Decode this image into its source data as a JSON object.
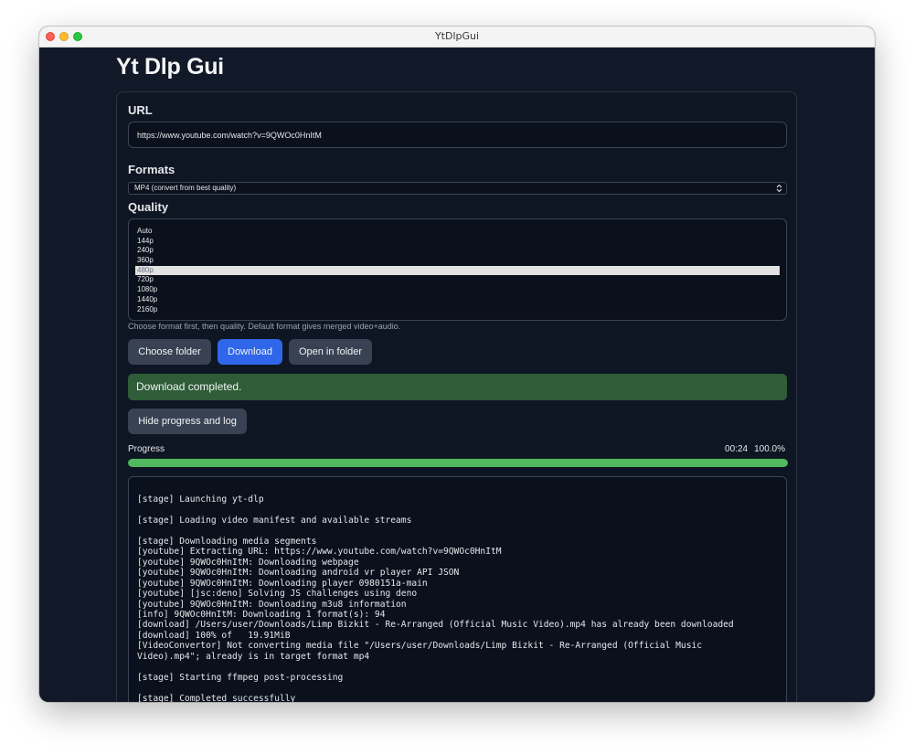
{
  "window": {
    "title": "YtDlpGui"
  },
  "app": {
    "title": "Yt Dlp Gui"
  },
  "url": {
    "label": "URL",
    "value": "https://www.youtube.com/watch?v=9QWOc0HnItM"
  },
  "formats": {
    "label": "Formats",
    "selected": "MP4 (convert from best quality)"
  },
  "quality": {
    "label": "Quality",
    "options": [
      "Auto",
      "144p",
      "240p",
      "360p",
      "480p",
      "720p",
      "1080p",
      "1440p",
      "2160p"
    ],
    "selected": "480p",
    "hint": "Choose format first, then quality. Default format gives merged video+audio."
  },
  "buttons": {
    "choose_folder": "Choose folder",
    "download": "Download",
    "open_in_folder": "Open in folder",
    "hide_progress": "Hide progress and log"
  },
  "status": {
    "message": "Download completed."
  },
  "progress": {
    "label": "Progress",
    "elapsed": "00:24",
    "percent_text": "100.0%",
    "fraction": 1.0
  },
  "log": {
    "lines": [
      "[stage] Launching yt-dlp",
      "",
      "[stage] Loading video manifest and available streams",
      "",
      "[stage] Downloading media segments",
      "[youtube] Extracting URL: https://www.youtube.com/watch?v=9QWOc0HnItM",
      "[youtube] 9QWOc0HnItM: Downloading webpage",
      "[youtube] 9QWOc0HnItM: Downloading android vr player API JSON",
      "[youtube] 9QWOc0HnItM: Downloading player 0980151a-main",
      "[youtube] [jsc:deno] Solving JS challenges using deno",
      "[youtube] 9QWOc0HnItM: Downloading m3u8 information",
      "[info] 9QWOc0HnItM: Downloading 1 format(s): 94",
      "[download] /Users/user/Downloads/Limp Bizkit - Re-Arranged (Official Music Video).mp4 has already been downloaded",
      "[download] 100% of   19.91MiB",
      "[VideoConvertor] Not converting media file \"/Users/user/Downloads/Limp Bizkit - Re-Arranged (Official Music",
      "Video).mp4\"; already is in target format mp4",
      "",
      "[stage] Starting ffmpeg post-processing",
      "",
      "[stage] Completed successfully"
    ]
  }
}
